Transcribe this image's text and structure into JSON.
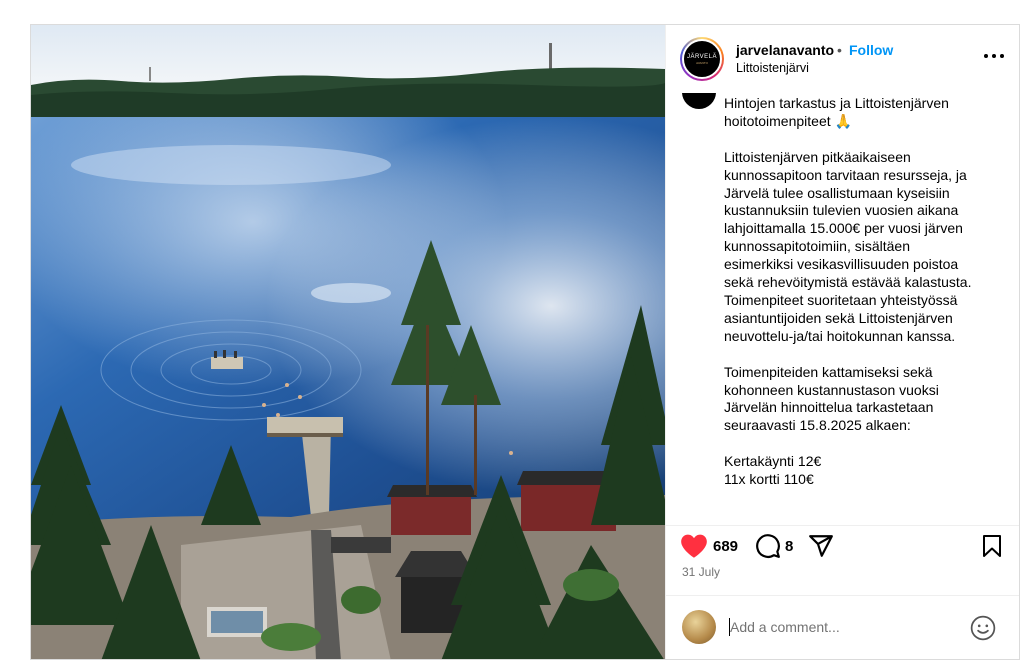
{
  "post": {
    "username": "jarvelanavanto",
    "separator": "•",
    "follow_label": "Follow",
    "location": "Littoistenjärvi",
    "avatar_logo_word": "JÄRVELÄ",
    "avatar_logo_sub": "AVANTO",
    "caption": "Hintojen tarkastus ja Littoistenjärven\nhoitotoimenpiteet 🙏\n\nLittoistenjärven pitkäaikaiseen\nkunnossapitoon tarvitaan resursseja, ja\nJärvelä tulee osallistumaan kyseisiin\nkustannuksiin tulevien vuosien aikana\nlahjoittamalla 15.000€ per vuosi järven\nkunnossapitotoimiin, sisältäen\nesimerkiksi vesikasvillisuuden poistoa\nsekä rehevöitymistä estävää kalastusta.\nToimenpiteet suoritetaan yhteistyössä\nasiantuntijoiden sekä Littoistenjärven\nneuvottelu-ja/tai hoitokunnan kanssa.\n\nToimenpiteiden kattamiseksi sekä\nkohonneen kustannustason vuoksi\nJärvelän hinnoittelua tarkastetaan\nseuraavasti 15.8.2025 alkaen:\n\nKertakäynti 12€\n11x kortti 110€",
    "likes": "689",
    "comments": "8",
    "date": "31 July",
    "comment_placeholder": "Add a comment..."
  },
  "icons": {
    "like": "heart-icon",
    "comment": "comment-icon",
    "share": "share-icon",
    "save": "bookmark-icon",
    "more": "more-options-icon",
    "emoji": "emoji-icon"
  },
  "colors": {
    "accent": "#0095f6",
    "heart": "#ff3040",
    "muted": "#737373",
    "border": "#dbdbdb"
  }
}
